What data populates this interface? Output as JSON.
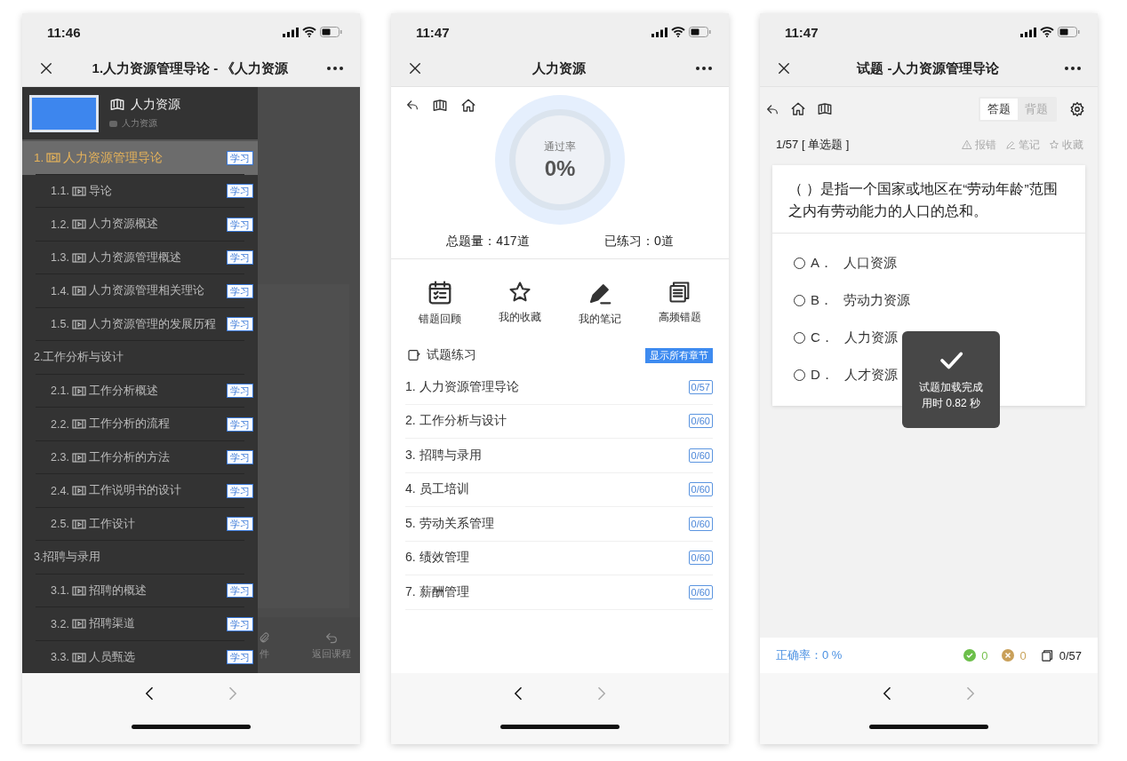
{
  "screens": [
    {
      "kind": "course_menu",
      "time": "11:46",
      "title": "1.人力资源管理导论 - 《人力资源",
      "course": {
        "title": "人力资源",
        "subtitle": "人力资源"
      },
      "chapters": [
        {
          "kind": "video",
          "number": "1.",
          "title": "人力资源管理导论",
          "badge": "学习",
          "selected": true,
          "children": [
            {
              "kind": "video",
              "number": "1.1.",
              "title": "导论",
              "badge": "学习",
              "selected": false
            },
            {
              "kind": "video",
              "number": "1.2.",
              "title": "人力资源概述",
              "badge": "学习",
              "selected": false
            },
            {
              "kind": "video",
              "number": "1.3.",
              "title": "人力资源管理概述",
              "badge": "学习",
              "selected": false
            },
            {
              "kind": "video",
              "number": "1.4.",
              "title": "人力资源管理相关理论",
              "badge": "学习",
              "selected": false
            },
            {
              "kind": "video",
              "number": "1.5.",
              "title": "人力资源管理的发展历程",
              "badge": "学习",
              "selected": false
            }
          ]
        },
        {
          "kind": "section",
          "number": "2.",
          "title": "工作分析与设计",
          "selected": false,
          "children": [
            {
              "kind": "video",
              "number": "2.1.",
              "title": "工作分析概述",
              "badge": "学习",
              "selected": false
            },
            {
              "kind": "video",
              "number": "2.2.",
              "title": "工作分析的流程",
              "badge": "学习",
              "selected": false
            },
            {
              "kind": "video",
              "number": "2.3.",
              "title": "工作分析的方法",
              "badge": "学习",
              "selected": false
            },
            {
              "kind": "video",
              "number": "2.4.",
              "title": "工作说明书的设计",
              "badge": "学习",
              "selected": false
            },
            {
              "kind": "video",
              "number": "2.5.",
              "title": "工作设计",
              "badge": "学习",
              "selected": false
            }
          ]
        },
        {
          "kind": "section",
          "number": "3.",
          "title": "招聘与录用",
          "selected": false,
          "children": [
            {
              "kind": "video",
              "number": "3.1.",
              "title": "招聘的概述",
              "badge": "学习",
              "selected": false
            },
            {
              "kind": "video",
              "number": "3.2.",
              "title": "招聘渠道",
              "badge": "学习",
              "selected": false
            },
            {
              "kind": "video",
              "number": "3.3.",
              "title": "人员甄选",
              "badge": "学习",
              "selected": false
            }
          ]
        }
      ],
      "background_tabs": [
        {
          "kind": "attachment",
          "label": "件"
        },
        {
          "kind": "return",
          "label": "返回课程"
        }
      ],
      "nav": [
        {
          "kind": "back",
          "disabled": false
        },
        {
          "kind": "forward",
          "disabled": true
        }
      ]
    },
    {
      "kind": "practice_home",
      "time": "11:47",
      "title": "人力资源",
      "gauge": {
        "label": "通过率",
        "value": "0%"
      },
      "stats": [
        "总题量：417道",
        "已练习：0道"
      ],
      "features": [
        {
          "kind": "review",
          "label": "错题回顾"
        },
        {
          "kind": "favorite",
          "label": "我的收藏"
        },
        {
          "kind": "notes",
          "label": "我的笔记"
        },
        {
          "kind": "frequent",
          "label": "高频错题"
        }
      ],
      "section": {
        "title": "试题练习",
        "button": "显示所有章节"
      },
      "chapters": [
        {
          "title": "1. 人力资源管理导论",
          "progress": "0/57"
        },
        {
          "title": "2. 工作分析与设计",
          "progress": "0/60"
        },
        {
          "title": "3. 招聘与录用",
          "progress": "0/60"
        },
        {
          "title": "4. 员工培训",
          "progress": "0/60"
        },
        {
          "title": "5. 劳动关系管理",
          "progress": "0/60"
        },
        {
          "title": "6. 绩效管理",
          "progress": "0/60"
        },
        {
          "title": "7. 薪酬管理",
          "progress": "0/60"
        }
      ],
      "nav": [
        {
          "kind": "back",
          "disabled": false
        },
        {
          "kind": "forward",
          "disabled": true
        }
      ]
    },
    {
      "kind": "question",
      "time": "11:47",
      "title": "试题 -人力资源管理导论",
      "modes": [
        {
          "label": "答题",
          "selected": true
        },
        {
          "label": "背题",
          "selected": false
        }
      ],
      "counter": "1/57",
      "type": "[ 单选题 ]",
      "actions": [
        {
          "kind": "report",
          "label": "报错"
        },
        {
          "kind": "note",
          "label": "笔记"
        },
        {
          "kind": "favorite",
          "label": "收藏"
        }
      ],
      "question": "（ ）是指一个国家或地区在“劳动年龄”范围之内有劳动能力的人口的总和。",
      "options": [
        {
          "letter": "A．",
          "text": "人口资源",
          "selected": false
        },
        {
          "letter": "B．",
          "text": "劳动力资源",
          "selected": false
        },
        {
          "letter": "C．",
          "text": "人力资源",
          "selected": false
        },
        {
          "letter": "D．",
          "text": "人才资源",
          "selected": false
        }
      ],
      "toast": {
        "title": "试题加载完成",
        "detail": "用时 0.82 秒"
      },
      "footer": {
        "accuracy": "正确率：0 %",
        "correct": "0",
        "wrong": "0",
        "progress": "0/57"
      },
      "nav": [
        {
          "kind": "back",
          "disabled": false
        },
        {
          "kind": "forward",
          "disabled": true
        }
      ]
    }
  ]
}
